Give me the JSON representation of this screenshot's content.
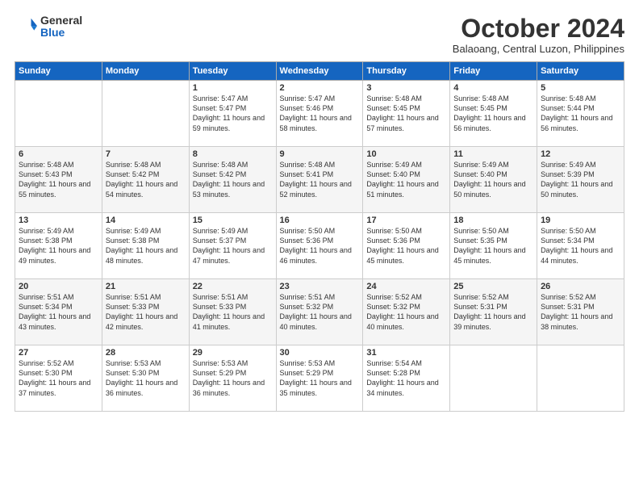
{
  "header": {
    "logo_general": "General",
    "logo_blue": "Blue",
    "month_title": "October 2024",
    "location": "Balaoang, Central Luzon, Philippines"
  },
  "weekdays": [
    "Sunday",
    "Monday",
    "Tuesday",
    "Wednesday",
    "Thursday",
    "Friday",
    "Saturday"
  ],
  "weeks": [
    [
      {
        "day": "",
        "info": ""
      },
      {
        "day": "",
        "info": ""
      },
      {
        "day": "1",
        "info": "Sunrise: 5:47 AM\nSunset: 5:47 PM\nDaylight: 11 hours and 59 minutes."
      },
      {
        "day": "2",
        "info": "Sunrise: 5:47 AM\nSunset: 5:46 PM\nDaylight: 11 hours and 58 minutes."
      },
      {
        "day": "3",
        "info": "Sunrise: 5:48 AM\nSunset: 5:45 PM\nDaylight: 11 hours and 57 minutes."
      },
      {
        "day": "4",
        "info": "Sunrise: 5:48 AM\nSunset: 5:45 PM\nDaylight: 11 hours and 56 minutes."
      },
      {
        "day": "5",
        "info": "Sunrise: 5:48 AM\nSunset: 5:44 PM\nDaylight: 11 hours and 56 minutes."
      }
    ],
    [
      {
        "day": "6",
        "info": "Sunrise: 5:48 AM\nSunset: 5:43 PM\nDaylight: 11 hours and 55 minutes."
      },
      {
        "day": "7",
        "info": "Sunrise: 5:48 AM\nSunset: 5:42 PM\nDaylight: 11 hours and 54 minutes."
      },
      {
        "day": "8",
        "info": "Sunrise: 5:48 AM\nSunset: 5:42 PM\nDaylight: 11 hours and 53 minutes."
      },
      {
        "day": "9",
        "info": "Sunrise: 5:48 AM\nSunset: 5:41 PM\nDaylight: 11 hours and 52 minutes."
      },
      {
        "day": "10",
        "info": "Sunrise: 5:49 AM\nSunset: 5:40 PM\nDaylight: 11 hours and 51 minutes."
      },
      {
        "day": "11",
        "info": "Sunrise: 5:49 AM\nSunset: 5:40 PM\nDaylight: 11 hours and 50 minutes."
      },
      {
        "day": "12",
        "info": "Sunrise: 5:49 AM\nSunset: 5:39 PM\nDaylight: 11 hours and 50 minutes."
      }
    ],
    [
      {
        "day": "13",
        "info": "Sunrise: 5:49 AM\nSunset: 5:38 PM\nDaylight: 11 hours and 49 minutes."
      },
      {
        "day": "14",
        "info": "Sunrise: 5:49 AM\nSunset: 5:38 PM\nDaylight: 11 hours and 48 minutes."
      },
      {
        "day": "15",
        "info": "Sunrise: 5:49 AM\nSunset: 5:37 PM\nDaylight: 11 hours and 47 minutes."
      },
      {
        "day": "16",
        "info": "Sunrise: 5:50 AM\nSunset: 5:36 PM\nDaylight: 11 hours and 46 minutes."
      },
      {
        "day": "17",
        "info": "Sunrise: 5:50 AM\nSunset: 5:36 PM\nDaylight: 11 hours and 45 minutes."
      },
      {
        "day": "18",
        "info": "Sunrise: 5:50 AM\nSunset: 5:35 PM\nDaylight: 11 hours and 45 minutes."
      },
      {
        "day": "19",
        "info": "Sunrise: 5:50 AM\nSunset: 5:34 PM\nDaylight: 11 hours and 44 minutes."
      }
    ],
    [
      {
        "day": "20",
        "info": "Sunrise: 5:51 AM\nSunset: 5:34 PM\nDaylight: 11 hours and 43 minutes."
      },
      {
        "day": "21",
        "info": "Sunrise: 5:51 AM\nSunset: 5:33 PM\nDaylight: 11 hours and 42 minutes."
      },
      {
        "day": "22",
        "info": "Sunrise: 5:51 AM\nSunset: 5:33 PM\nDaylight: 11 hours and 41 minutes."
      },
      {
        "day": "23",
        "info": "Sunrise: 5:51 AM\nSunset: 5:32 PM\nDaylight: 11 hours and 40 minutes."
      },
      {
        "day": "24",
        "info": "Sunrise: 5:52 AM\nSunset: 5:32 PM\nDaylight: 11 hours and 40 minutes."
      },
      {
        "day": "25",
        "info": "Sunrise: 5:52 AM\nSunset: 5:31 PM\nDaylight: 11 hours and 39 minutes."
      },
      {
        "day": "26",
        "info": "Sunrise: 5:52 AM\nSunset: 5:31 PM\nDaylight: 11 hours and 38 minutes."
      }
    ],
    [
      {
        "day": "27",
        "info": "Sunrise: 5:52 AM\nSunset: 5:30 PM\nDaylight: 11 hours and 37 minutes."
      },
      {
        "day": "28",
        "info": "Sunrise: 5:53 AM\nSunset: 5:30 PM\nDaylight: 11 hours and 36 minutes."
      },
      {
        "day": "29",
        "info": "Sunrise: 5:53 AM\nSunset: 5:29 PM\nDaylight: 11 hours and 36 minutes."
      },
      {
        "day": "30",
        "info": "Sunrise: 5:53 AM\nSunset: 5:29 PM\nDaylight: 11 hours and 35 minutes."
      },
      {
        "day": "31",
        "info": "Sunrise: 5:54 AM\nSunset: 5:28 PM\nDaylight: 11 hours and 34 minutes."
      },
      {
        "day": "",
        "info": ""
      },
      {
        "day": "",
        "info": ""
      }
    ]
  ]
}
